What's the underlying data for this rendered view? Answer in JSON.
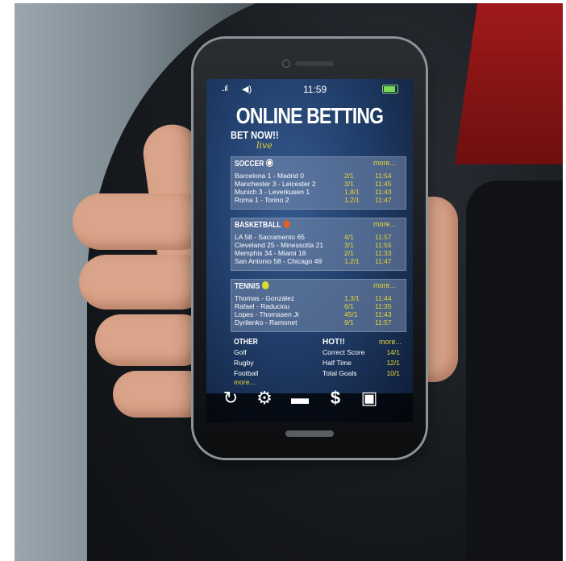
{
  "status": {
    "signal": "..ıl",
    "time": "11:59"
  },
  "title": "ONLINE BETTING",
  "bet_now": "BET NOW!!",
  "live": "live",
  "soccer": {
    "header": "SOCCER",
    "more": "more...",
    "rows": [
      {
        "match": "Barcelona 1 - Madrid 0",
        "odds": "2/1",
        "time": "11:54"
      },
      {
        "match": "Manchester 3 - Leicester 2",
        "odds": "3/1",
        "time": "11:45"
      },
      {
        "match": "Munich 3 - Leverkusen 1",
        "odds": "1,8/1",
        "time": "11:43"
      },
      {
        "match": "Roma 1 - Torino 2",
        "odds": "1,2/1",
        "time": "11:47"
      }
    ]
  },
  "basketball": {
    "header": "BASKETBALL",
    "more": "more...",
    "rows": [
      {
        "match": "LA 58 - Sacramento 65",
        "odds": "4/1",
        "time": "11:57"
      },
      {
        "match": "Cleveland 25 - Minessotta 21",
        "odds": "3/1",
        "time": "11:55"
      },
      {
        "match": "Memphis 34 - Miami 18",
        "odds": "2/1",
        "time": "11:33"
      },
      {
        "match": "San Antonio 58 - Chicago 49",
        "odds": "1,2/1",
        "time": "11:47"
      }
    ]
  },
  "tennis": {
    "header": "TENNIS",
    "more": "more...",
    "rows": [
      {
        "match": "Thomas - González",
        "odds": "1,3/1",
        "time": "11:44"
      },
      {
        "match": "Rafael - Raduciou",
        "odds": "6/1",
        "time": "11:35"
      },
      {
        "match": "Lopes - Thomasen Jr",
        "odds": "45/1",
        "time": "11:43"
      },
      {
        "match": "Dyrilenko - Ramonet",
        "odds": "9/1",
        "time": "11:57"
      }
    ]
  },
  "other": {
    "header": "OTHER",
    "items": [
      "Golf",
      "Rugby",
      "Football"
    ],
    "more": "more..."
  },
  "hot": {
    "header": "HOT!!",
    "more": "more...",
    "rows": [
      {
        "label": "Correct Score",
        "value": "14/1"
      },
      {
        "label": "Half Time",
        "value": "12/1"
      },
      {
        "label": "Total Goals",
        "value": "10/1"
      }
    ]
  },
  "icons": [
    "refresh-icon",
    "gear-icon",
    "folder-icon",
    "dollar-icon",
    "radio-icon"
  ],
  "colors": {
    "accent": "#e6d63a",
    "screen": "#213e6a",
    "battery": "#7cd958"
  }
}
